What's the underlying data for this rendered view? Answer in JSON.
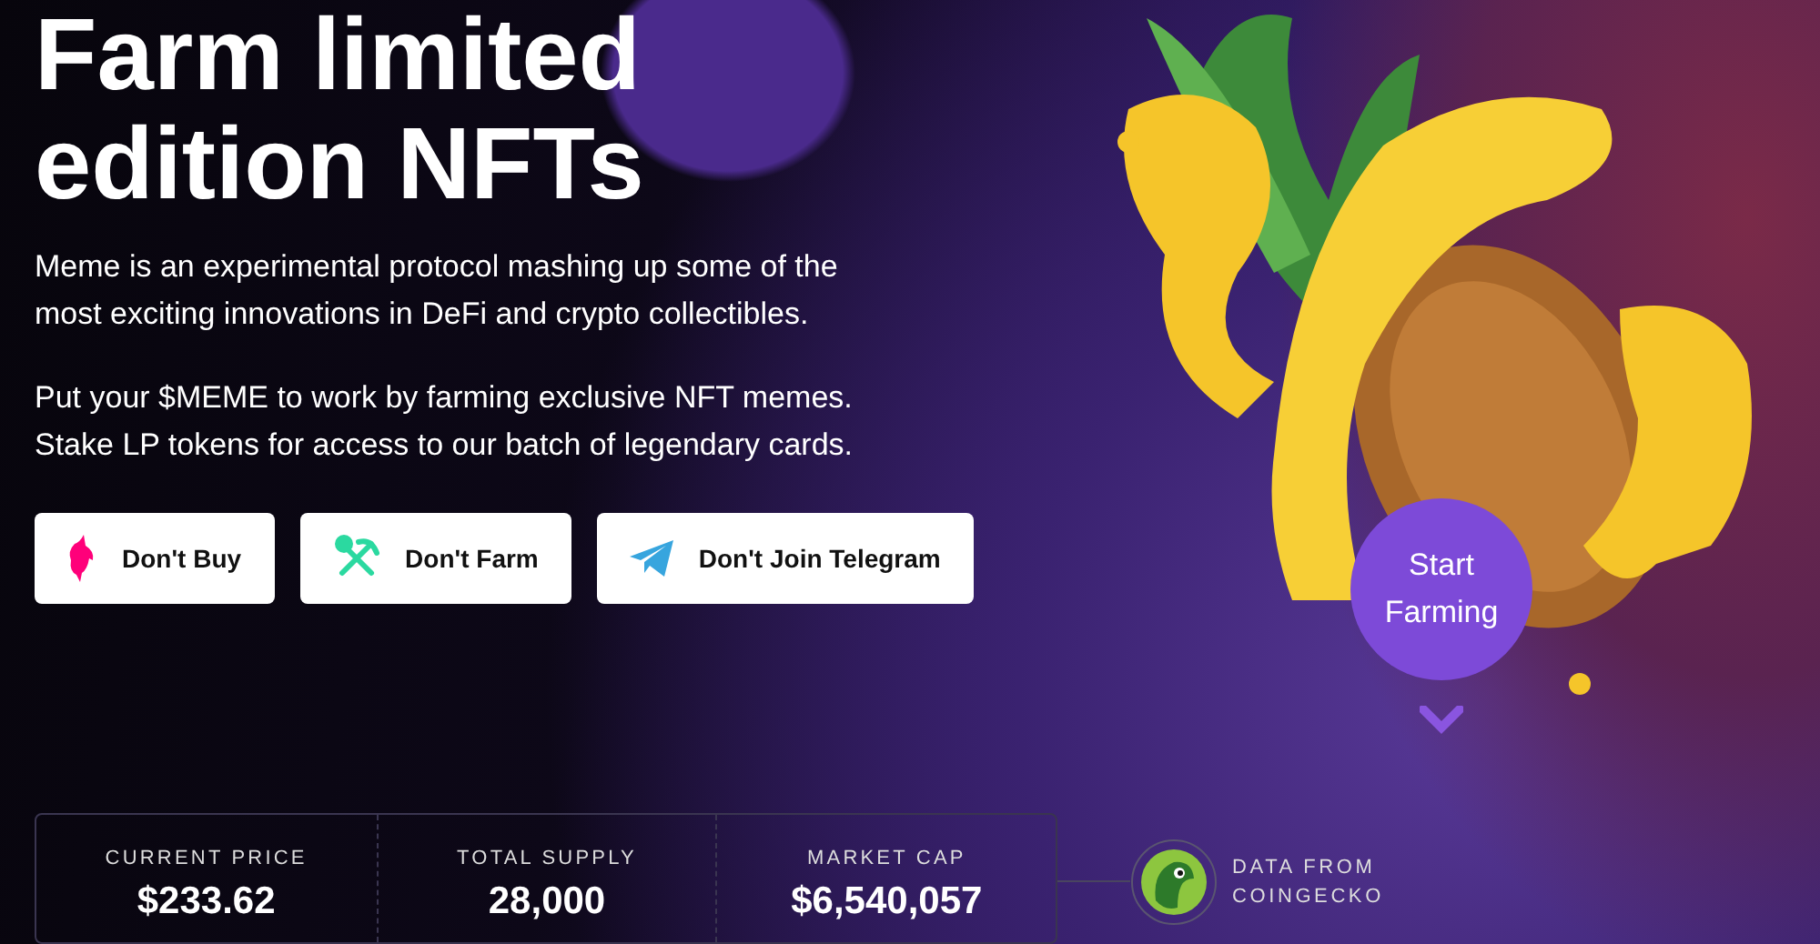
{
  "hero": {
    "title_lines": [
      "Farm limited",
      "edition NFTs"
    ],
    "paragraphs": [
      "Meme is an experimental protocol mashing up some of the most exciting innovations in DeFi and crypto collectibles.",
      "Put your $MEME to work by farming exclusive NFT memes. Stake LP tokens for access to our batch of legendary cards."
    ]
  },
  "buttons": [
    {
      "label": "Don't Buy",
      "kind": "unicorn"
    },
    {
      "label": "Don't Farm",
      "kind": "pickaxe"
    },
    {
      "label": "Don't Join Telegram",
      "kind": "plane"
    }
  ],
  "start_button": {
    "label": "Start Farming"
  },
  "stats": [
    {
      "label": "CURRENT PRICE",
      "value": "$233.62"
    },
    {
      "label": "TOTAL SUPPLY",
      "value": "28,000"
    },
    {
      "label": "MARKET CAP",
      "value": "$6,540,057"
    }
  ],
  "data_source": {
    "label": "DATA FROM COINGECKO"
  }
}
